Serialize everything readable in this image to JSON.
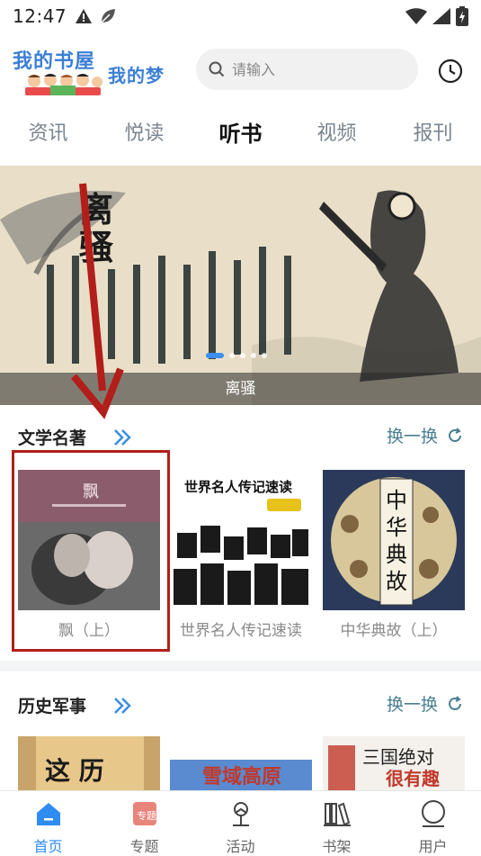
{
  "status_bar": {
    "time": "12:47"
  },
  "header": {
    "logo_line1": "我的书屋",
    "logo_line2": "我的梦",
    "search_placeholder": "请输入"
  },
  "tabs": [
    {
      "label": "资讯",
      "active": false
    },
    {
      "label": "悦读",
      "active": false
    },
    {
      "label": "听书",
      "active": true
    },
    {
      "label": "视频",
      "active": false
    },
    {
      "label": "报刊",
      "active": false
    }
  ],
  "banner": {
    "caption": "离骚",
    "artwork_title": "离骚",
    "slide_count": 5,
    "active_slide": 1
  },
  "sections": [
    {
      "title": "文学名著",
      "swap_label": "换一换",
      "books": [
        {
          "title": "飘（上）",
          "cover_text": "飘"
        },
        {
          "title": "世界名人传记速读",
          "cover_text": "世界名人传记速读"
        },
        {
          "title": "中华典故（上）",
          "cover_text": "中华典故"
        }
      ]
    },
    {
      "title": "历史军事",
      "swap_label": "换一换",
      "books": [
        {
          "title": "",
          "cover_text": "这么历史"
        },
        {
          "title": "",
          "cover_text": "雪域高原"
        },
        {
          "title": "",
          "cover_text": "三国绝对很有趣"
        }
      ]
    }
  ],
  "bottom_nav": [
    {
      "label": "首页",
      "icon": "home-icon",
      "active": true
    },
    {
      "label": "专题",
      "icon": "topic-icon",
      "active": false
    },
    {
      "label": "活动",
      "icon": "activity-icon",
      "active": false
    },
    {
      "label": "书架",
      "icon": "bookshelf-icon",
      "active": false
    },
    {
      "label": "用户",
      "icon": "user-icon",
      "active": false
    }
  ],
  "colors": {
    "accent": "#2f8cf0",
    "section_link": "#4a7f90",
    "annotation_red": "#b21e1a"
  }
}
